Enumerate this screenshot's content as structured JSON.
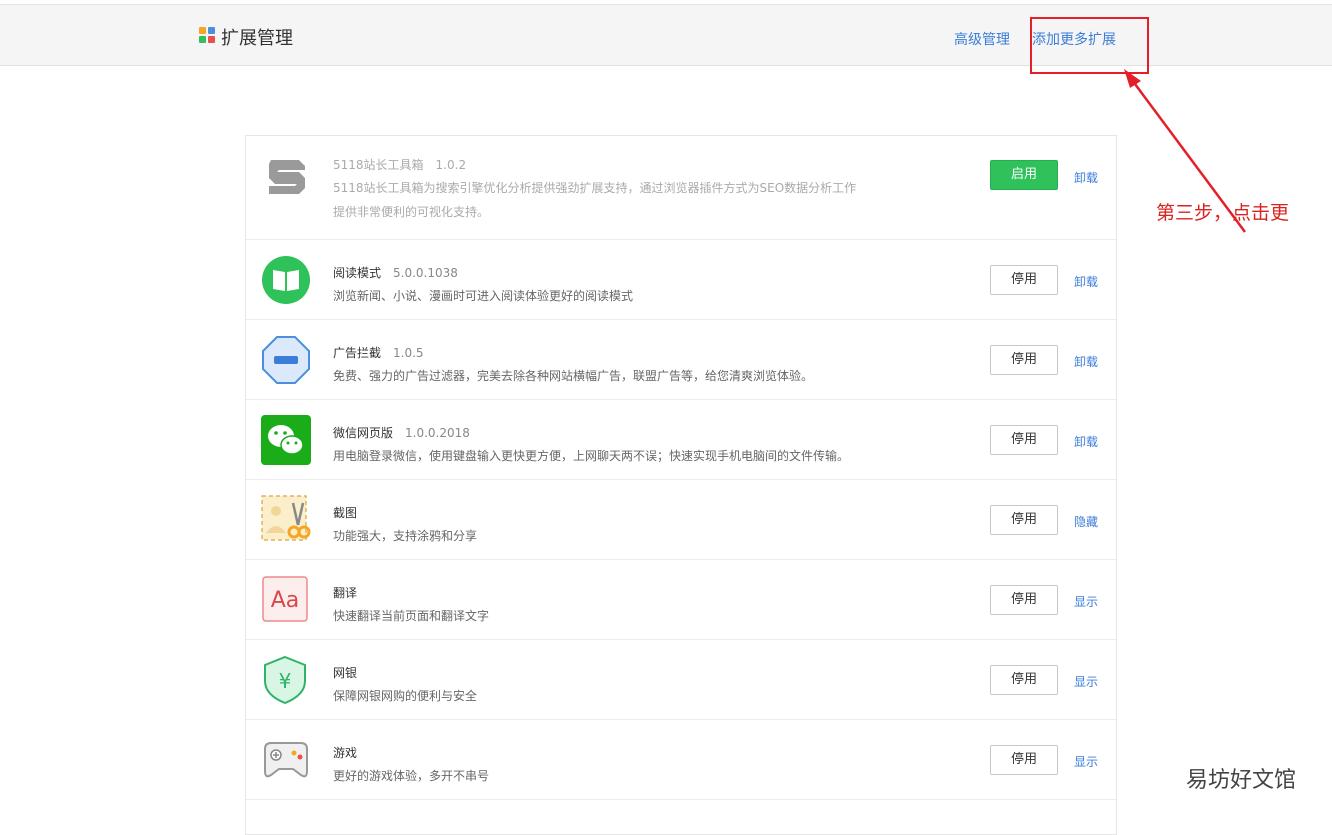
{
  "header": {
    "title": "扩展管理",
    "links": [
      {
        "label": "高级管理"
      },
      {
        "label": "添加更多扩展"
      }
    ]
  },
  "extensions": [
    {
      "name": "5118站长工具箱",
      "version": "1.0.2",
      "description": [
        "5118站长工具箱为搜索引擎优化分析提供强劲扩展支持，通过浏览器插件方式为SEO数据分析工作",
        "提供非常便利的可视化支持。"
      ],
      "button": "启用",
      "link": "卸载",
      "icon": "5118-logo-icon",
      "state": "disabled"
    },
    {
      "name": "阅读模式",
      "version": "5.0.0.1038",
      "description": [
        "浏览新闻、小说、漫画时可进入阅读体验更好的阅读模式"
      ],
      "button": "停用",
      "link": "卸载",
      "icon": "book-icon",
      "state": "enabled"
    },
    {
      "name": "广告拦截",
      "version": "1.0.5",
      "description": [
        "免费、强力的广告过滤器，完美去除各种网站横幅广告，联盟广告等，给您清爽浏览体验。"
      ],
      "button": "停用",
      "link": "卸载",
      "icon": "ad-block-icon",
      "state": "enabled"
    },
    {
      "name": "微信网页版",
      "version": "1.0.0.2018",
      "description": [
        "用电脑登录微信，使用键盘输入更快更方便，上网聊天两不误；快速实现手机电脑间的文件传输。"
      ],
      "button": "停用",
      "link": "卸载",
      "icon": "wechat-icon",
      "state": "enabled"
    },
    {
      "name": "截图",
      "version": "",
      "description": [
        "功能强大，支持涂鸦和分享"
      ],
      "button": "停用",
      "link": "隐藏",
      "icon": "screenshot-scissors-icon",
      "state": "enabled"
    },
    {
      "name": "翻译",
      "version": "",
      "description": [
        "快速翻译当前页面和翻译文字"
      ],
      "button": "停用",
      "link": "显示",
      "icon": "translate-icon",
      "icon_text": "Aa",
      "state": "enabled"
    },
    {
      "name": "网银",
      "version": "",
      "description": [
        "保障网银网购的便利与安全"
      ],
      "button": "停用",
      "link": "显示",
      "icon": "shield-yen-icon",
      "icon_text": "¥",
      "state": "enabled"
    },
    {
      "name": "游戏",
      "version": "",
      "description": [
        "更好的游戏体验，多开不串号"
      ],
      "button": "停用",
      "link": "显示",
      "icon": "gamepad-icon",
      "state": "enabled"
    }
  ],
  "annotation": "第三步，点击更",
  "watermark": "易坊好文馆",
  "colors": {
    "link": "#3b7dd8",
    "enable_button": "#2fc25b",
    "annotation_red": "#e3202a"
  }
}
